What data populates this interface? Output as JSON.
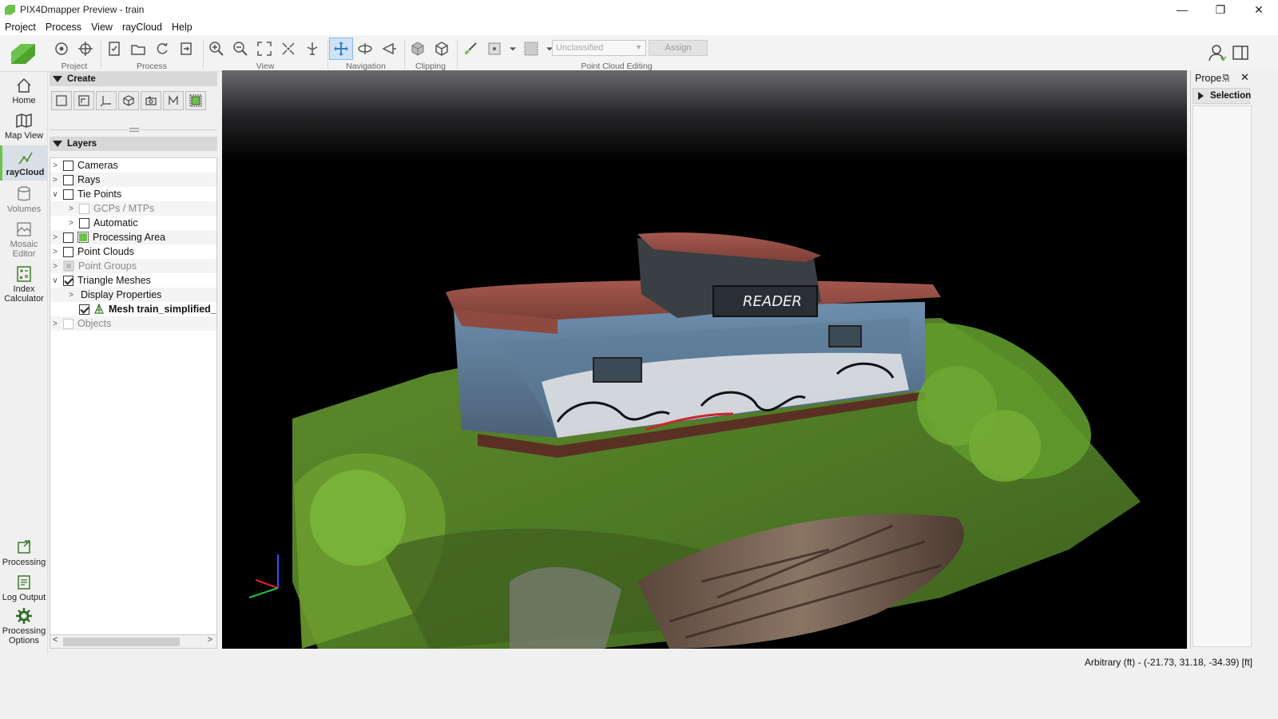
{
  "window": {
    "title": "PIX4Dmapper Preview - train",
    "controls": [
      "—",
      "❐",
      "✕"
    ]
  },
  "menu": [
    "Project",
    "Process",
    "View",
    "rayCloud",
    "Help"
  ],
  "toolbar": {
    "groups": [
      {
        "label": "Project"
      },
      {
        "label": "Process"
      },
      {
        "label": "View"
      },
      {
        "label": "Navigation"
      },
      {
        "label": "Clipping"
      },
      {
        "label": "Point Cloud Editing"
      }
    ],
    "class_select": "Unclassified",
    "assign_label": "Assign"
  },
  "leftnav": [
    {
      "label": "Home",
      "icon": "home-icon"
    },
    {
      "label": "Map View",
      "icon": "map-icon"
    },
    {
      "label": "rayCloud",
      "icon": "raycloud-icon",
      "selected": true
    },
    {
      "label": "Volumes",
      "icon": "volumes-icon"
    },
    {
      "label": "Mosaic Editor",
      "icon": "mosaic-icon"
    },
    {
      "label": "Index Calculator",
      "icon": "calculator-icon"
    },
    {
      "label": "Processing",
      "icon": "processing-icon"
    },
    {
      "label": "Log Output",
      "icon": "log-icon"
    },
    {
      "label": "Processing Options",
      "icon": "gear-icon"
    }
  ],
  "panels": {
    "create": "Create",
    "layers": "Layers"
  },
  "layers": [
    {
      "label": "Cameras",
      "checked": false
    },
    {
      "label": "Rays",
      "checked": false
    },
    {
      "label": "Tie Points",
      "checked": false,
      "expanded": true
    },
    {
      "label": "GCPs / MTPs",
      "checked": false,
      "disabled": true
    },
    {
      "label": "Automatic",
      "checked": false
    },
    {
      "label": "Processing Area",
      "checked": false
    },
    {
      "label": "Point Clouds",
      "checked": false
    },
    {
      "label": "Point Groups",
      "checked": false,
      "disabled": true
    },
    {
      "label": "Triangle Meshes",
      "checked": true,
      "expanded": true
    },
    {
      "label": "Display Properties"
    },
    {
      "label": "Mesh train_simplified_",
      "checked": true,
      "bold": true
    },
    {
      "label": "Objects",
      "checked": false,
      "disabled": true
    }
  ],
  "properties": {
    "title": "Prope...",
    "section": "Selection"
  },
  "status": {
    "coordinates": "Arbitrary (ft) - (-21.73, 31.18, -34.39) [ft]"
  },
  "scene_text": {
    "caboose_sign": "READER"
  },
  "colors": {
    "brand_green": "#6cc24a",
    "accent_blue": "#3a7dc9"
  }
}
